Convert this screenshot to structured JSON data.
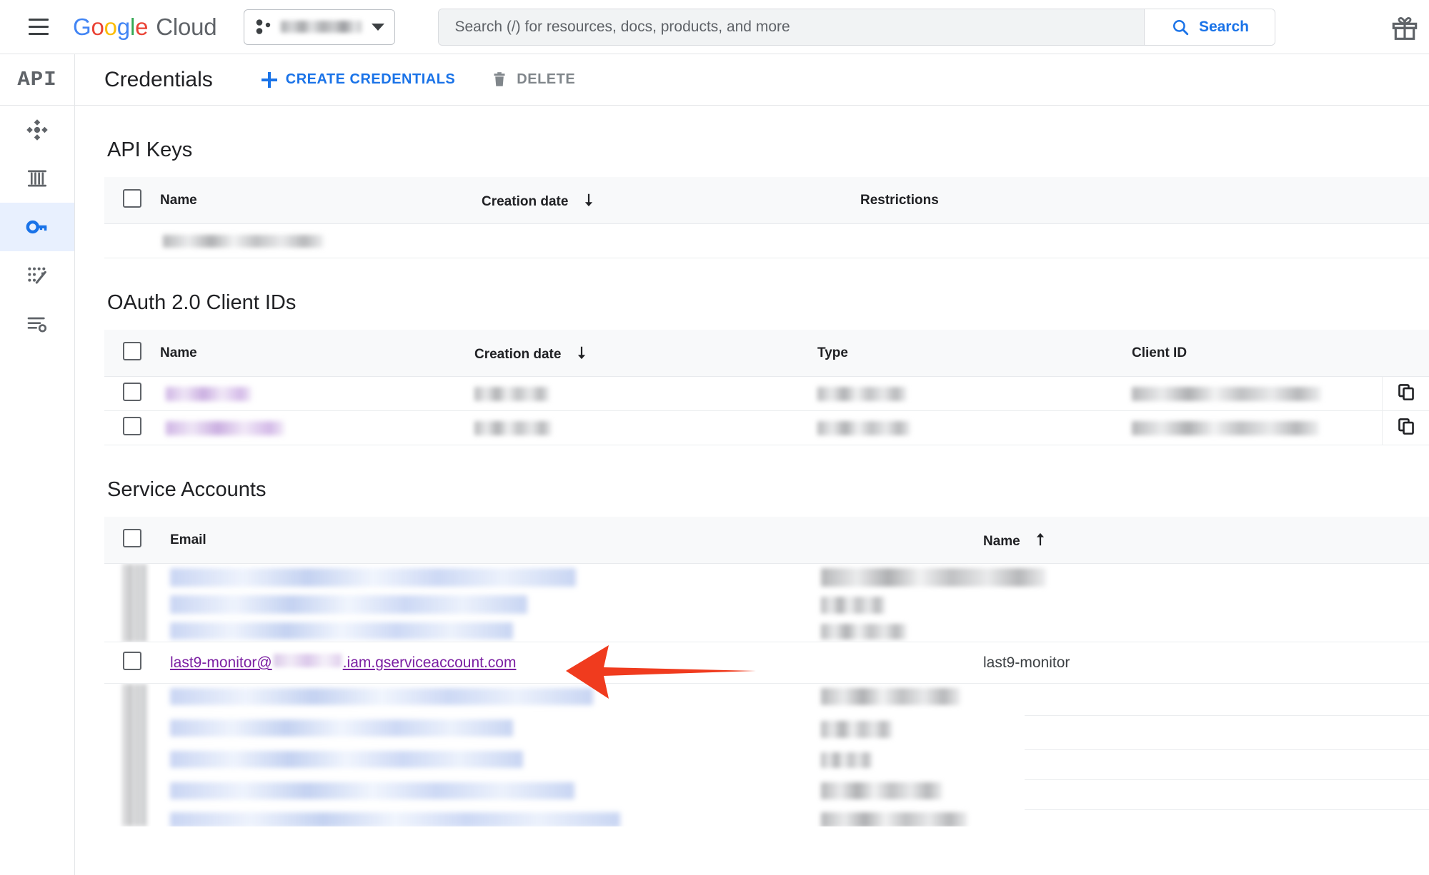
{
  "topbar": {
    "menu_icon": "hamburger-menu-icon",
    "brand": {
      "google": "Google",
      "cloud": "Cloud"
    },
    "project_picker": {
      "icon": "project-dots-icon",
      "value_redacted": "",
      "caret_icon": "chevron-down-icon"
    },
    "search": {
      "placeholder": "Search (/) for resources, docs, products, and more",
      "value": "",
      "button_label": "Search",
      "button_icon": "search-icon"
    },
    "gift_icon": "gift-icon"
  },
  "rail": {
    "header_label": "API",
    "items": [
      {
        "name": "sidebar-item-enabled-apis",
        "icon": "hub-icon",
        "selected": false
      },
      {
        "name": "sidebar-item-library",
        "icon": "library-icon",
        "selected": false
      },
      {
        "name": "sidebar-item-credentials",
        "icon": "key-icon",
        "selected": true
      },
      {
        "name": "sidebar-item-metrics",
        "icon": "metrics-icon",
        "selected": false
      },
      {
        "name": "sidebar-item-settings",
        "icon": "settings-list-icon",
        "selected": false
      }
    ]
  },
  "page": {
    "title": "Credentials",
    "create_button": {
      "label": "CREATE CREDENTIALS",
      "icon": "plus-icon"
    },
    "delete_button": {
      "label": "DELETE",
      "icon": "trash-icon",
      "disabled": true
    }
  },
  "api_keys": {
    "section_title": "API Keys",
    "columns": [
      "Name",
      "Creation date",
      "Restrictions"
    ],
    "sort_column": "Creation date",
    "sort_direction": "desc",
    "rows": [
      {
        "name": "",
        "creation_date": "",
        "restrictions": "",
        "redacted": true
      }
    ]
  },
  "oauth_clients": {
    "section_title": "OAuth 2.0 Client IDs",
    "columns": [
      "Name",
      "Creation date",
      "Type",
      "Client ID"
    ],
    "sort_column": "Creation date",
    "sort_direction": "desc",
    "copy_icon": "copy-icon",
    "rows": [
      {
        "name": "",
        "creation_date": "",
        "type": "",
        "client_id": "",
        "redacted": true
      },
      {
        "name": "",
        "creation_date": "",
        "type": "",
        "client_id": "",
        "redacted": true
      }
    ]
  },
  "service_accounts": {
    "section_title": "Service Accounts",
    "columns": [
      "Email",
      "Name"
    ],
    "sort_column": "Name",
    "sort_direction": "asc",
    "rows_above": [
      {
        "email": "",
        "name": "",
        "redacted": true
      },
      {
        "email": "",
        "name": "",
        "redacted": true
      },
      {
        "email": "",
        "name": "",
        "redacted": true
      }
    ],
    "highlighted_row": {
      "email_prefix": "last9-monitor@",
      "email_suffix": ".iam.gserviceaccount.com",
      "email_redacted_middle": true,
      "name": "last9-monitor"
    },
    "rows_below": [
      {
        "email": "",
        "name": "",
        "redacted": true
      },
      {
        "email": "",
        "name": "",
        "redacted": true
      },
      {
        "email": "",
        "name": "",
        "redacted": true
      },
      {
        "email": "",
        "name": "",
        "redacted": true
      },
      {
        "email": "",
        "name": "",
        "redacted": true
      }
    ]
  },
  "annotation": {
    "arrow": {
      "name": "red-arrow-annotation",
      "color": "#f03b1e",
      "direction": "left",
      "points_to": "last9-monitor service account email"
    }
  },
  "colors": {
    "accent_blue": "#1a73e8",
    "selected_rail_bg": "#e8f0fe",
    "visited_link_purple": "#7b1fa2",
    "header_grey": "#f8f9fa",
    "annotation_red": "#f03b1e"
  }
}
